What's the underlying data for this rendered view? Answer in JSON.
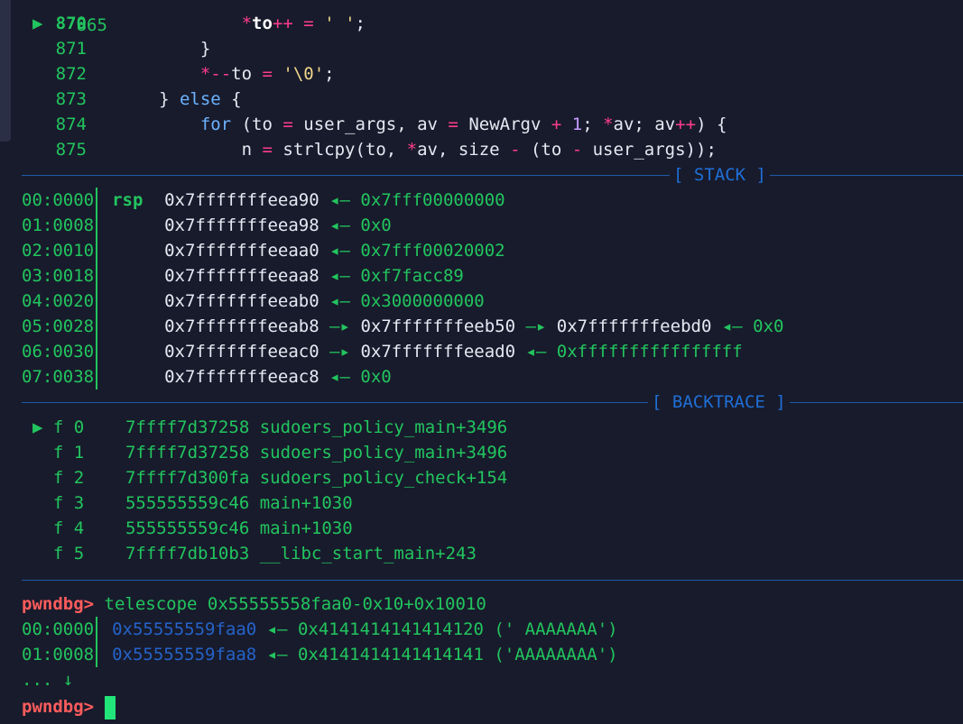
{
  "source": {
    "partial_top_line": "865",
    "lines": [
      {
        "num": "870",
        "current": true,
        "indent": "            ",
        "code": [
          [
            "op",
            "*"
          ],
          [
            "var",
            "to"
          ],
          [
            "op",
            "++"
          ],
          [
            "plain",
            " "
          ],
          [
            "op",
            "="
          ],
          [
            "plain",
            " "
          ],
          [
            "str",
            "' '"
          ],
          [
            "plain",
            ";"
          ]
        ]
      },
      {
        "num": "871",
        "indent": "        ",
        "code": [
          [
            "plain",
            "}"
          ]
        ]
      },
      {
        "num": "872",
        "indent": "        ",
        "code": [
          [
            "op",
            "*--"
          ],
          [
            "plain",
            "to "
          ],
          [
            "op",
            "="
          ],
          [
            "plain",
            " "
          ],
          [
            "str",
            "'\\0'"
          ],
          [
            "plain",
            ";"
          ]
        ]
      },
      {
        "num": "873",
        "indent": "    ",
        "code": [
          [
            "plain",
            "} "
          ],
          [
            "kw",
            "else"
          ],
          [
            "plain",
            " {"
          ]
        ]
      },
      {
        "num": "874",
        "indent": "        ",
        "code": [
          [
            "kw",
            "for"
          ],
          [
            "plain",
            " (to "
          ],
          [
            "op",
            "="
          ],
          [
            "plain",
            " user_args, av "
          ],
          [
            "op",
            "="
          ],
          [
            "plain",
            " NewArgv "
          ],
          [
            "op",
            "+"
          ],
          [
            "plain",
            " "
          ],
          [
            "num",
            "1"
          ],
          [
            "plain",
            "; "
          ],
          [
            "op",
            "*"
          ],
          [
            "plain",
            "av; av"
          ],
          [
            "op",
            "++"
          ],
          [
            "plain",
            ") {"
          ]
        ]
      },
      {
        "num": "875",
        "indent": "            ",
        "code": [
          [
            "plain",
            "n "
          ],
          [
            "op",
            "="
          ],
          [
            "plain",
            " strlcpy(to, "
          ],
          [
            "op",
            "*"
          ],
          [
            "plain",
            "av, size "
          ],
          [
            "op",
            "-"
          ],
          [
            "plain",
            " (to "
          ],
          [
            "op",
            "-"
          ],
          [
            "plain",
            " user_args));"
          ]
        ]
      }
    ]
  },
  "stack_title": "[ STACK ]",
  "stack": [
    {
      "off": "00:0000",
      "reg": "rsp",
      "segs": [
        [
          "addr",
          "0x7fffffffeea90"
        ],
        [
          "green",
          " ◂— 0x7fff00000000"
        ]
      ]
    },
    {
      "off": "01:0008",
      "reg": "",
      "segs": [
        [
          "addr",
          "0x7fffffffeea98"
        ],
        [
          "green",
          " ◂— 0x0"
        ]
      ]
    },
    {
      "off": "02:0010",
      "reg": "",
      "segs": [
        [
          "addr",
          "0x7fffffffeeaa0"
        ],
        [
          "green",
          " ◂— 0x7fff00020002"
        ]
      ]
    },
    {
      "off": "03:0018",
      "reg": "",
      "segs": [
        [
          "addr",
          "0x7fffffffeeaa8"
        ],
        [
          "green",
          " ◂— 0xf7facc89"
        ]
      ]
    },
    {
      "off": "04:0020",
      "reg": "",
      "segs": [
        [
          "addr",
          "0x7fffffffeeab0"
        ],
        [
          "green",
          " ◂— 0x3000000000"
        ]
      ]
    },
    {
      "off": "05:0028",
      "reg": "",
      "segs": [
        [
          "addr",
          "0x7fffffffeeab8"
        ],
        [
          "green",
          " —▸ "
        ],
        [
          "addr",
          "0x7fffffffeeb50"
        ],
        [
          "green",
          " —▸ "
        ],
        [
          "addr",
          "0x7fffffffeebd0"
        ],
        [
          "green",
          " ◂— 0x0"
        ]
      ]
    },
    {
      "off": "06:0030",
      "reg": "",
      "segs": [
        [
          "addr",
          "0x7fffffffeeac0"
        ],
        [
          "green",
          " —▸ "
        ],
        [
          "addr",
          "0x7fffffffeead0"
        ],
        [
          "green",
          " ◂— 0xffffffffffffffff"
        ]
      ]
    },
    {
      "off": "07:0038",
      "reg": "",
      "segs": [
        [
          "addr",
          "0x7fffffffeeac8"
        ],
        [
          "green",
          " ◂— 0x0"
        ]
      ]
    }
  ],
  "backtrace_title": "[ BACKTRACE ]",
  "backtrace": [
    {
      "current": true,
      "frame": "f 0",
      "addr": "7ffff7d37258",
      "sym": "sudoers_policy_main+3496"
    },
    {
      "current": false,
      "frame": "f 1",
      "addr": "7ffff7d37258",
      "sym": "sudoers_policy_main+3496"
    },
    {
      "current": false,
      "frame": "f 2",
      "addr": "7ffff7d300fa",
      "sym": "sudoers_policy_check+154"
    },
    {
      "current": false,
      "frame": "f 3",
      "addr": "555555559c46",
      "sym": "main+1030"
    },
    {
      "current": false,
      "frame": "f 4",
      "addr": "555555559c46",
      "sym": "main+1030"
    },
    {
      "current": false,
      "frame": "f 5",
      "addr": "7ffff7db10b3",
      "sym": "__libc_start_main+243"
    }
  ],
  "prompt": "pwndbg>",
  "command": " telescope 0x55555558faa0-0x10+0x10010",
  "telescope": [
    {
      "off": "00:0000",
      "addr": "0x55555559faa0",
      "rest": " ◂— 0x4141414141414120 (' AAAAAAA')"
    },
    {
      "off": "01:0008",
      "addr": "0x55555559faa8",
      "rest": " ◂— 0x4141414141414141 ('AAAAAAAA')"
    }
  ],
  "ellipsis": "... ↓"
}
